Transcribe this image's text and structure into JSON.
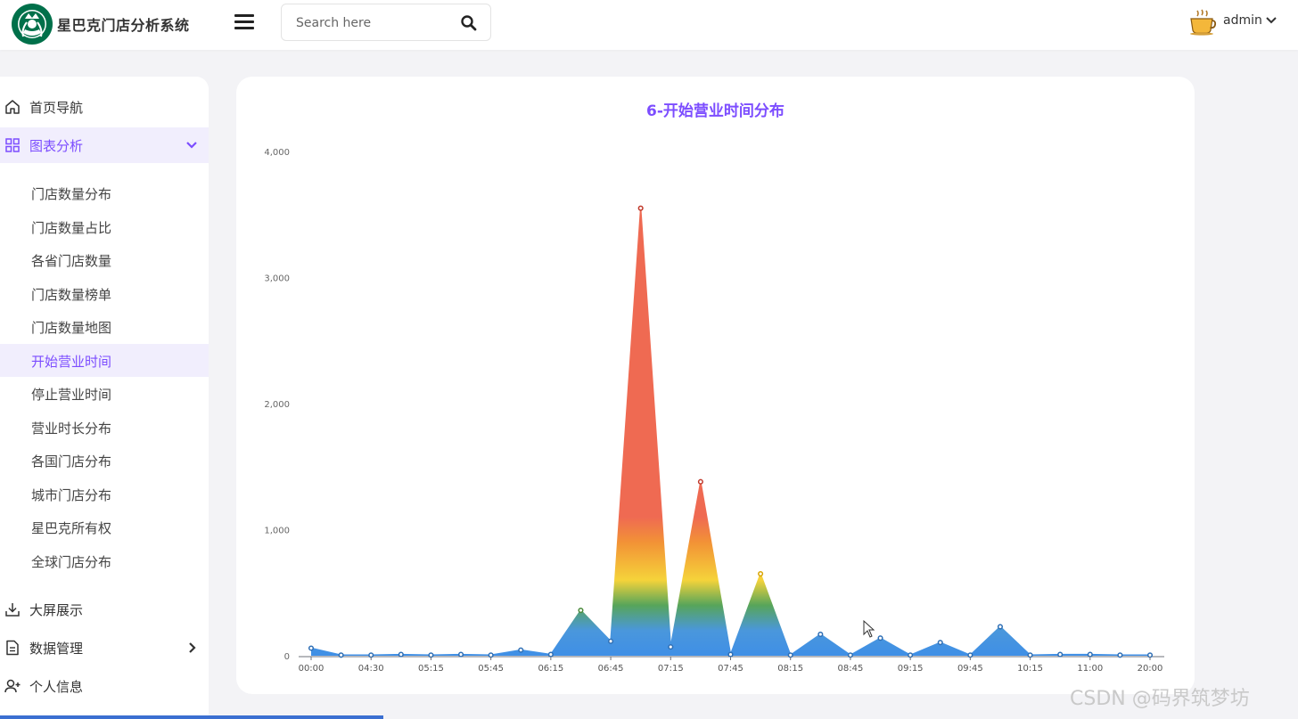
{
  "app": {
    "title": "星巴克门店分析系统"
  },
  "header": {
    "search_placeholder": "Search here",
    "user_name": "admin"
  },
  "sidebar": {
    "top_items": [
      {
        "label": "首页导航",
        "icon": "home-icon"
      },
      {
        "label": "图表分析",
        "icon": "grid-icon"
      }
    ],
    "sub_items": [
      "门店数量分布",
      "门店数量占比",
      "各省门店数量",
      "门店数量榜单",
      "门店数量地图",
      "开始营业时间",
      "停止营业时间",
      "营业时长分布",
      "各国门店分布",
      "城市门店分布",
      "星巴克所有权",
      "全球门店分布"
    ],
    "active_sub_index": 5,
    "bottom_items": [
      {
        "label": "大屏展示",
        "icon": "download-icon"
      },
      {
        "label": "数据管理",
        "icon": "document-icon"
      },
      {
        "label": "个人信息",
        "icon": "user-add-icon"
      }
    ]
  },
  "chart_data": {
    "type": "area",
    "title": "6-开始营业时间分布",
    "xlabel": "",
    "ylabel": "",
    "ylim": [
      0,
      4000
    ],
    "y_ticks": [
      "0",
      "1,000",
      "2,000",
      "3,000",
      "4,000"
    ],
    "x_tick_labels": [
      "00:00",
      "04:30",
      "05:15",
      "05:45",
      "06:15",
      "06:45",
      "07:15",
      "07:45",
      "08:15",
      "08:45",
      "09:15",
      "09:45",
      "10:15",
      "11:00",
      "20:00"
    ],
    "values": [
      60,
      5,
      5,
      10,
      5,
      10,
      5,
      45,
      10,
      360,
      115,
      3550,
      70,
      1380,
      10,
      650,
      5,
      170,
      5,
      140,
      5,
      105,
      5,
      230,
      5,
      10,
      10,
      5,
      5
    ],
    "grid": false,
    "legend": "none",
    "gradient_stops": [
      {
        "value": 0,
        "color": "#3f8fe6"
      },
      {
        "value": 200,
        "color": "#4a97dc"
      },
      {
        "value": 400,
        "color": "#57a55a"
      },
      {
        "value": 600,
        "color": "#f5d33a"
      },
      {
        "value": 900,
        "color": "#f29236"
      },
      {
        "value": 1100,
        "color": "#ef6a52"
      },
      {
        "value": 4000,
        "color": "#ef6a52"
      }
    ]
  },
  "watermark": "CSDN @码界筑梦坊"
}
